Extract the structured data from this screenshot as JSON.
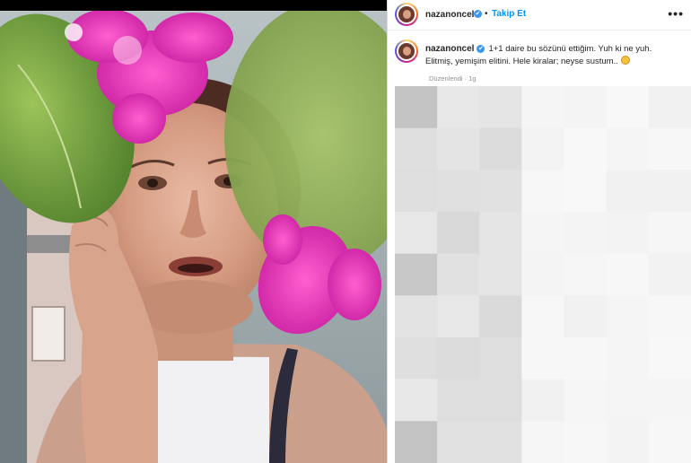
{
  "post": {
    "username": "nazanoncel",
    "verified_mark": "✔",
    "separator": "•",
    "follow_label": "Takip Et",
    "more_icon": "•••",
    "caption_text": "1+1 daire bu sözünü ettiğim. Yuh ki ne yuh. Elitmiş, yemişim elitini. Hele kiralar; neyse sustum..",
    "meta": "Düzenlendi · 1g"
  },
  "colors": {
    "link_blue": "#0095f6",
    "verified_blue": "#3897f0",
    "text": "#262626",
    "muted": "#8e8e8e",
    "border": "#dbdbdb"
  },
  "icons": {
    "verified": "verified-badge-icon",
    "more": "more-options-icon",
    "emoji": "smiling-emoji-icon"
  }
}
